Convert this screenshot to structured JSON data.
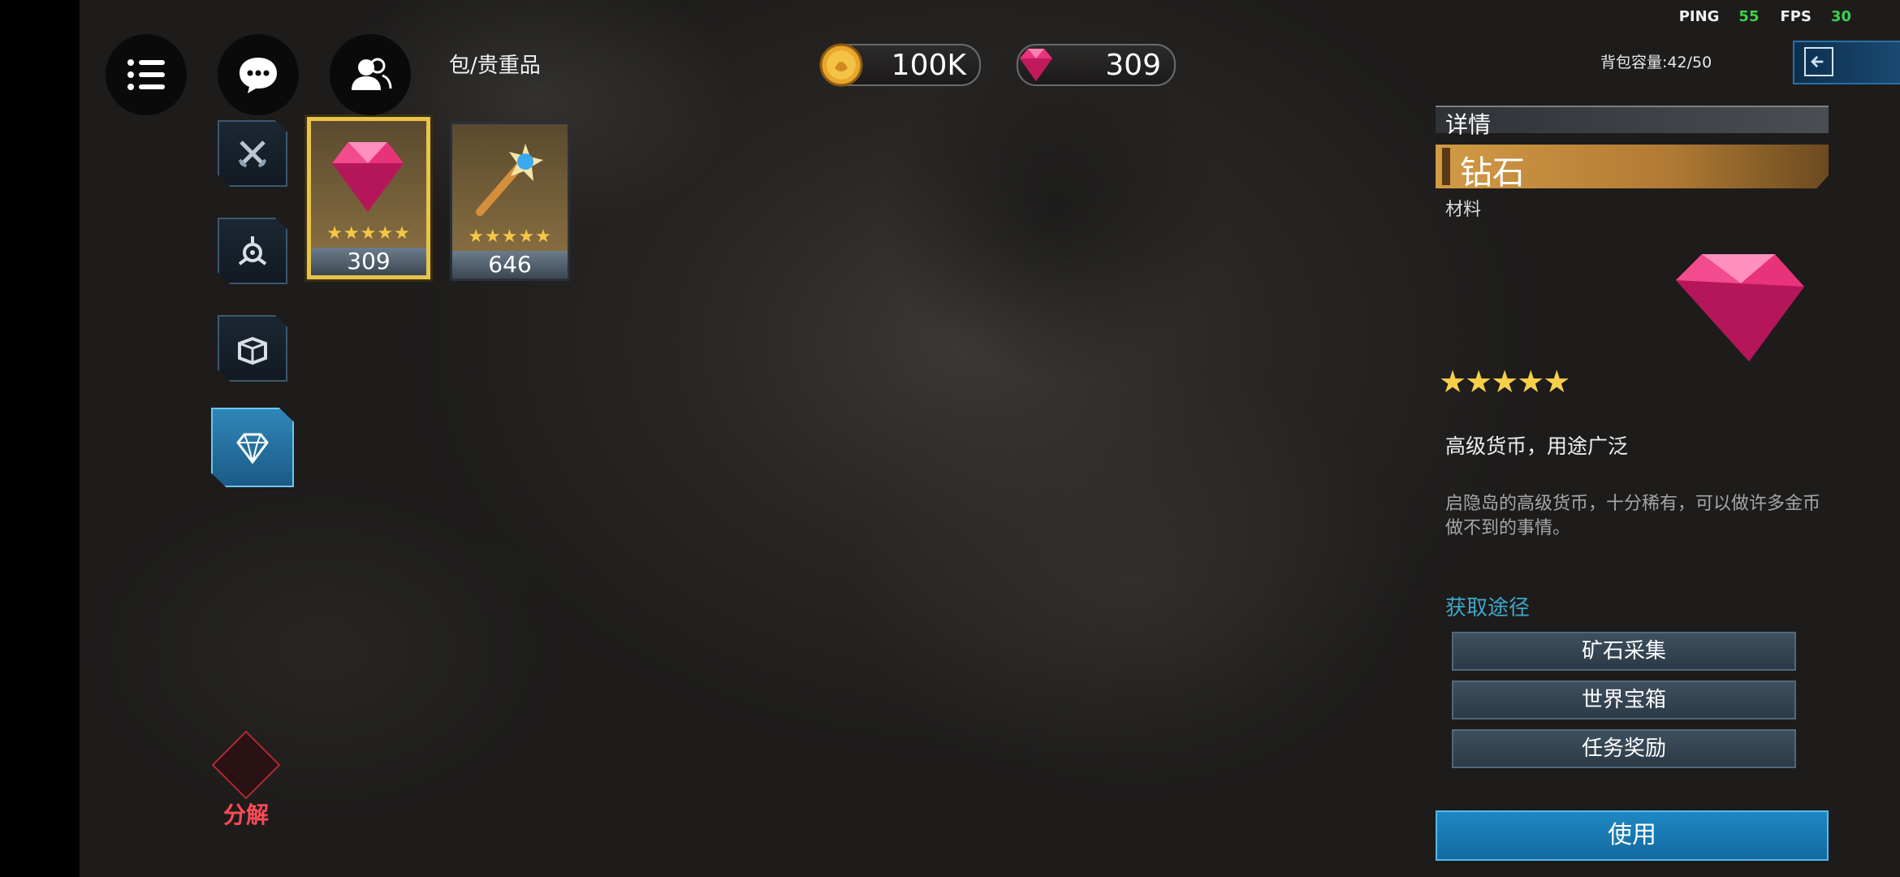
{
  "stats": {
    "ping_label": "PING",
    "ping_value": "55",
    "fps_label": "FPS",
    "fps_value": "30"
  },
  "breadcrumb": "包/贵重品",
  "currency": {
    "gold": "100K",
    "diamond": "309"
  },
  "capacity": "背包容量:42/50",
  "categories": [
    "weapon",
    "gear",
    "box",
    "valuables"
  ],
  "active_category": "valuables",
  "decompose_label": "分解",
  "items": [
    {
      "name": "diamond",
      "stars": "★★★★★",
      "count": "309",
      "selected": true
    },
    {
      "name": "magic-wand",
      "stars": "★★★★★",
      "count": "646",
      "selected": false
    }
  ],
  "detail": {
    "header": "详情",
    "name": "钻石",
    "category": "材料",
    "stars": "★★★★★",
    "summary": "高级货币，用途广泛",
    "description": "启隐岛的高级货币，十分稀有，可以做许多金币做不到的事情。",
    "source_title": "获取途径",
    "sources": [
      "矿石采集",
      "世界宝箱",
      "任务奖励"
    ],
    "use_label": "使用"
  },
  "colors": {
    "accent_blue": "#1e88c4",
    "gold_bar": "#d29a45",
    "star": "#f5c748",
    "green_stat": "#3fd04e"
  }
}
